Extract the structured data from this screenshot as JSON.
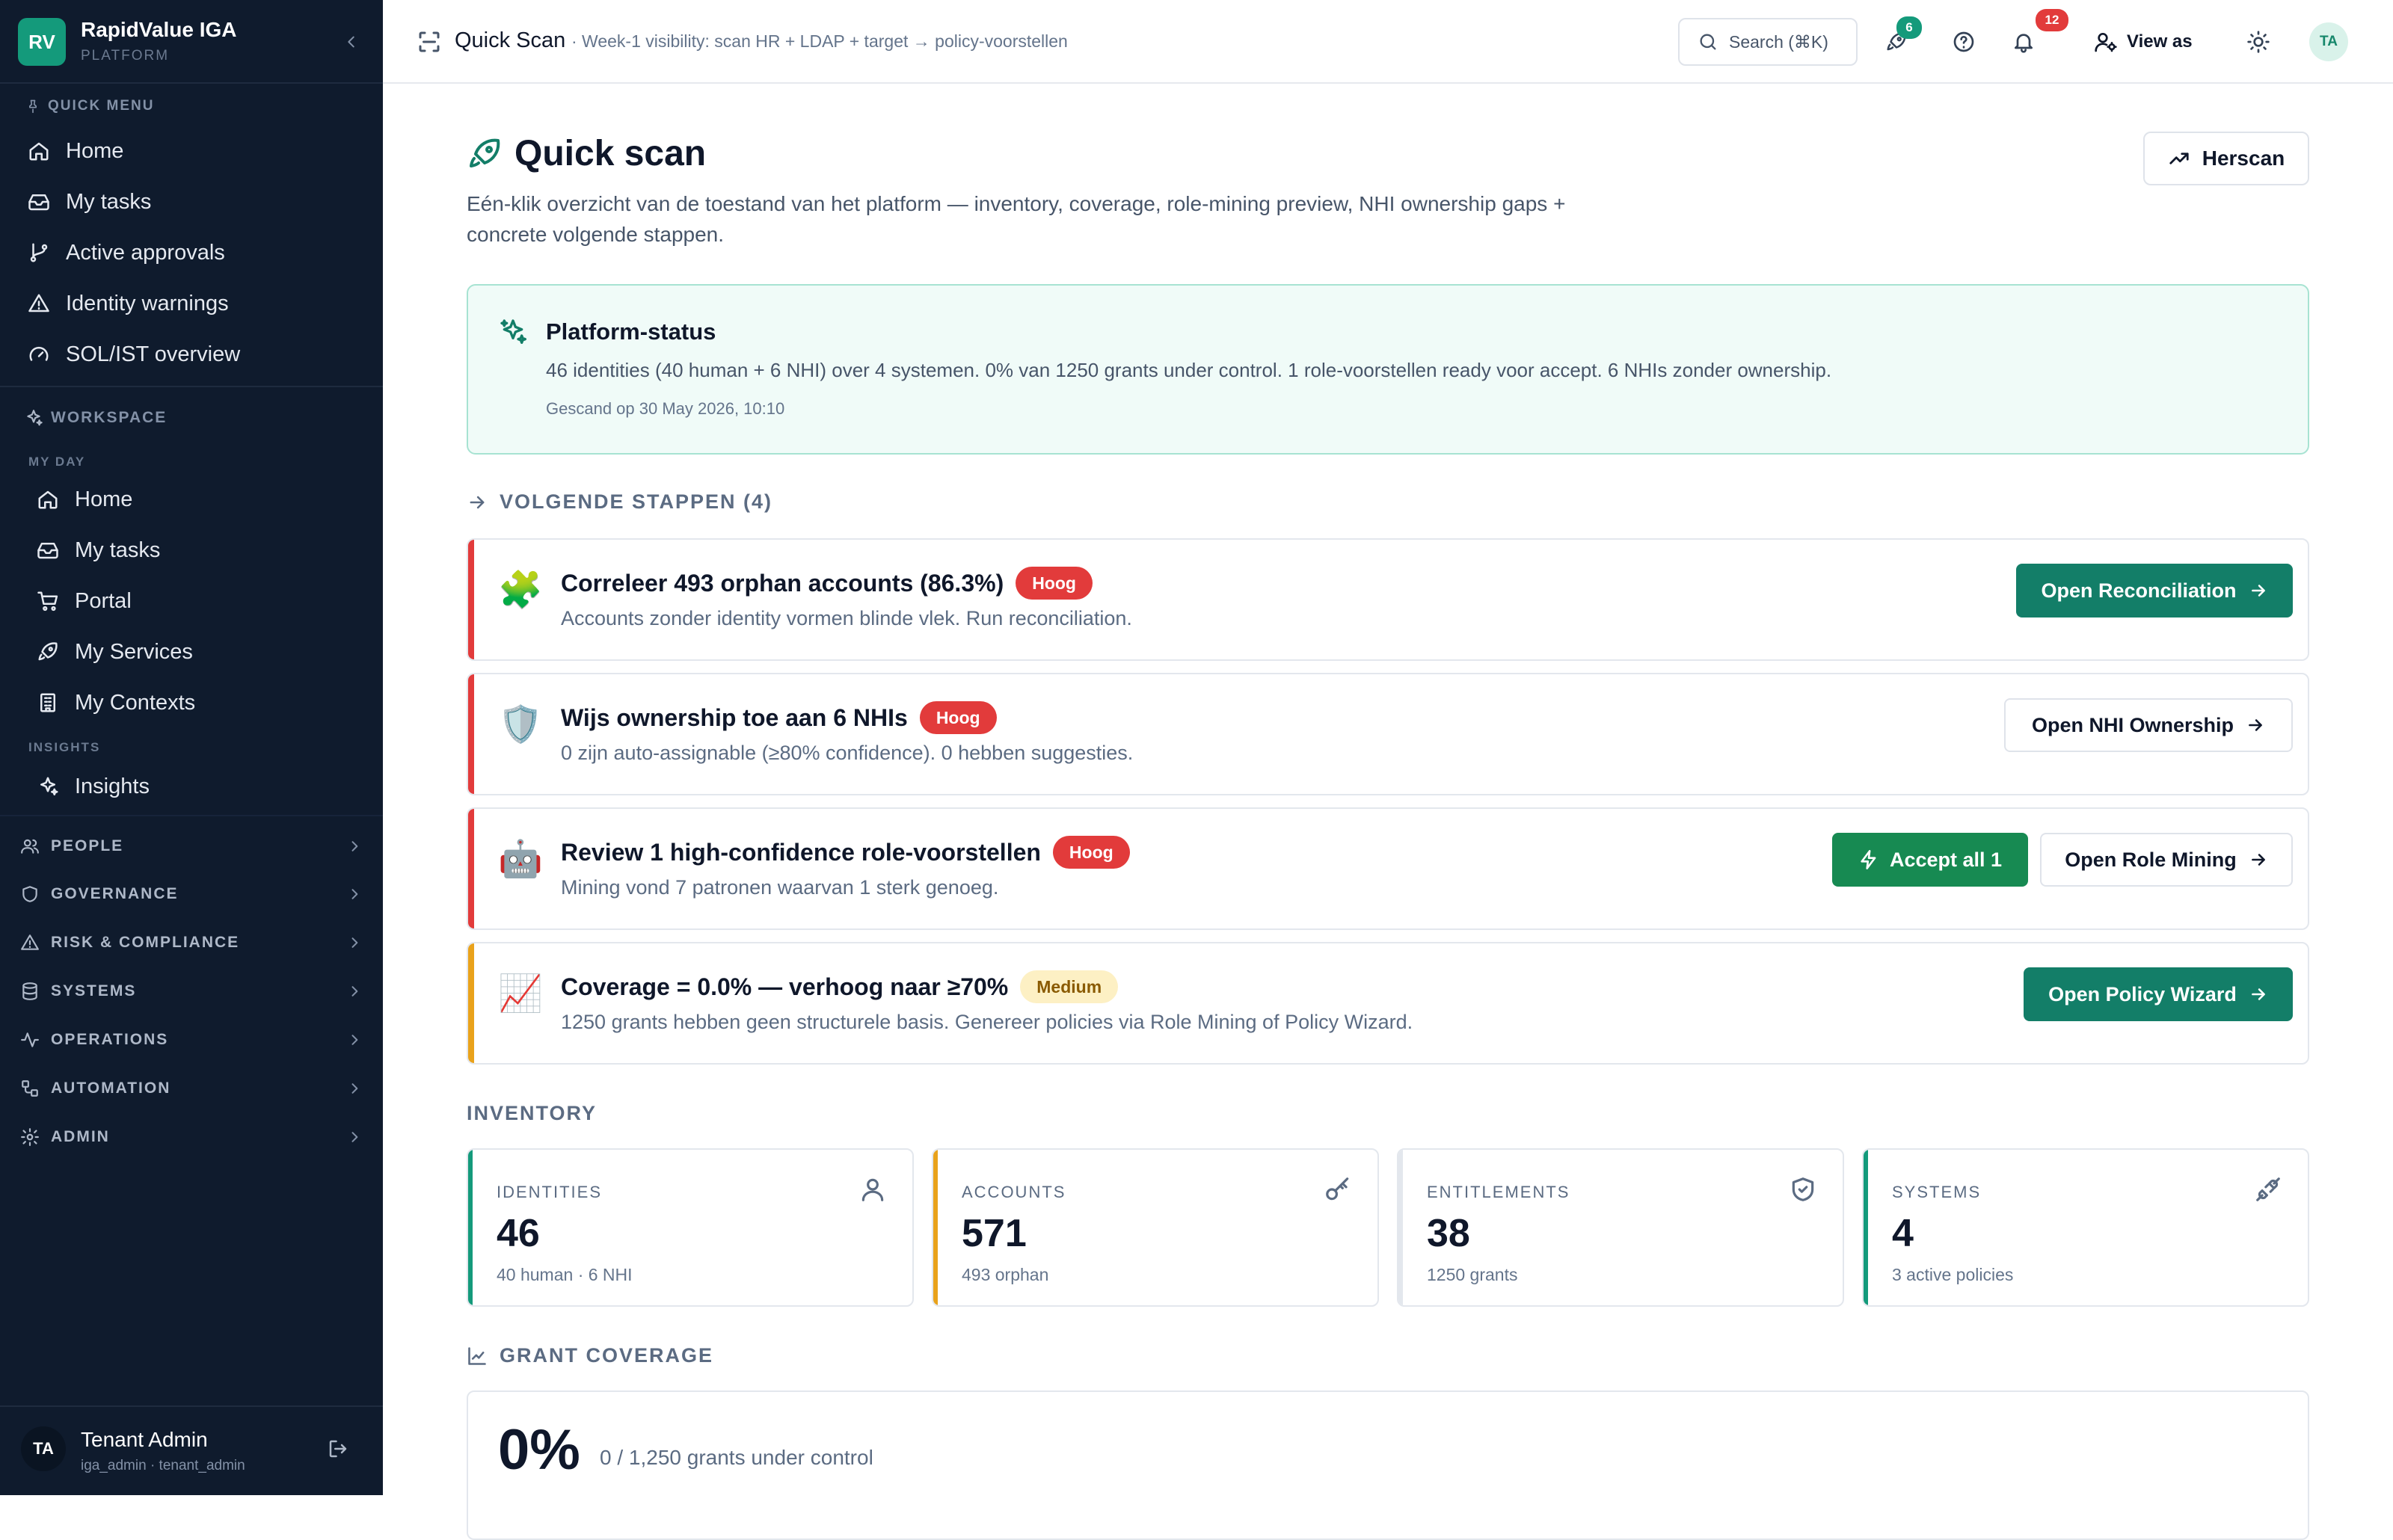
{
  "brand": {
    "logo": "RV",
    "name": "RapidValue IGA",
    "sub": "PLATFORM"
  },
  "sidebar": {
    "quick_menu_label": "QUICK MENU",
    "quick_menu": [
      {
        "label": "Home",
        "icon": "home-icon"
      },
      {
        "label": "My tasks",
        "icon": "inbox-icon"
      },
      {
        "label": "Active approvals",
        "icon": "git-branch-icon"
      },
      {
        "label": "Identity warnings",
        "icon": "warning-icon"
      },
      {
        "label": "SOL/IST overview",
        "icon": "gauge-icon"
      }
    ],
    "workspace_label": "WORKSPACE",
    "my_day_label": "MY DAY",
    "my_day": [
      {
        "label": "Home",
        "icon": "home-icon"
      },
      {
        "label": "My tasks",
        "icon": "inbox-icon"
      },
      {
        "label": "Portal",
        "icon": "cart-icon"
      },
      {
        "label": "My Services",
        "icon": "rocket-icon"
      },
      {
        "label": "My Contexts",
        "icon": "building-icon"
      }
    ],
    "insights_label": "INSIGHTS",
    "insights": [
      {
        "label": "Insights",
        "icon": "sparkles-icon"
      }
    ],
    "groups": [
      {
        "label": "PEOPLE",
        "icon": "people-icon"
      },
      {
        "label": "GOVERNANCE",
        "icon": "shield-icon"
      },
      {
        "label": "RISK & COMPLIANCE",
        "icon": "warning-icon"
      },
      {
        "label": "SYSTEMS",
        "icon": "database-icon"
      },
      {
        "label": "OPERATIONS",
        "icon": "activity-icon"
      },
      {
        "label": "AUTOMATION",
        "icon": "workflow-icon"
      },
      {
        "label": "ADMIN",
        "icon": "gear-icon"
      }
    ],
    "user": {
      "initials": "TA",
      "name": "Tenant Admin",
      "role": "iga_admin · tenant_admin"
    }
  },
  "topbar": {
    "title": "Quick Scan",
    "subtitle": "· Week-1 visibility: scan HR + LDAP + target → policy-voorstellen",
    "search_label": "Search (⌘K)",
    "rocket_badge": "6",
    "bell_badge": "12",
    "view_as": "View as",
    "avatar": "TA"
  },
  "page": {
    "title": "Quick scan",
    "description": "Eén-klik overzicht van de toestand van het platform — inventory, coverage, role-mining preview, NHI ownership gaps + concrete volgende stappen.",
    "rescan_label": "Herscan"
  },
  "status": {
    "title": "Platform-status",
    "text": "46 identities (40 human + 6 NHI) over 4 systemen. 0% van 1250 grants under control. 1 role-voorstellen ready voor accept. 6 NHIs zonder ownership.",
    "scanned": "Gescand op 30 May 2026, 10:10"
  },
  "next_steps_label": "VOLGENDE STAPPEN (4)",
  "steps": [
    {
      "emoji": "🧩",
      "title": "Correleer 493 orphan accounts (86.3%)",
      "priority": "Hoog",
      "description": "Accounts zonder identity vormen blinde vlek. Run reconciliation.",
      "action": "Open Reconciliation"
    },
    {
      "emoji": "🛡️",
      "title": "Wijs ownership toe aan 6 NHIs",
      "priority": "Hoog",
      "description": "0 zijn auto-assignable (≥80% confidence). 0 hebben suggesties.",
      "action": "Open NHI Ownership"
    },
    {
      "emoji": "🤖",
      "title": "Review 1 high-confidence role-voorstellen",
      "priority": "Hoog",
      "description": "Mining vond 7 patronen waarvan 1 sterk genoeg.",
      "accept": "Accept all 1",
      "action": "Open Role Mining"
    },
    {
      "emoji": "📈",
      "title": "Coverage = 0.0% — verhoog naar ≥70%",
      "priority": "Medium",
      "description": "1250 grants hebben geen structurele basis. Genereer policies via Role Mining of Policy Wizard.",
      "action": "Open Policy Wizard"
    }
  ],
  "inventory_label": "INVENTORY",
  "inventory": [
    {
      "label": "IDENTITIES",
      "value": "46",
      "sub": "40 human · 6 NHI",
      "icon": "user-icon",
      "color": "#149a7b"
    },
    {
      "label": "ACCOUNTS",
      "value": "571",
      "sub": "493 orphan",
      "icon": "key-icon",
      "color": "#e9a21b"
    },
    {
      "label": "ENTITLEMENTS",
      "value": "38",
      "sub": "1250 grants",
      "icon": "shield-check-icon",
      "color": "#e3e7ed"
    },
    {
      "label": "SYSTEMS",
      "value": "4",
      "sub": "3 active policies",
      "icon": "plug-icon",
      "color": "#149a7b"
    }
  ],
  "coverage_label": "GRANT COVERAGE",
  "coverage": {
    "value": "0%",
    "sub": "0 / 1,250 grants under control"
  },
  "colors": {
    "accent": "#137e68",
    "sidebar_bg": "#0f1b2d",
    "high": "#e23b3b",
    "medium_bar": "#e9a21b"
  }
}
